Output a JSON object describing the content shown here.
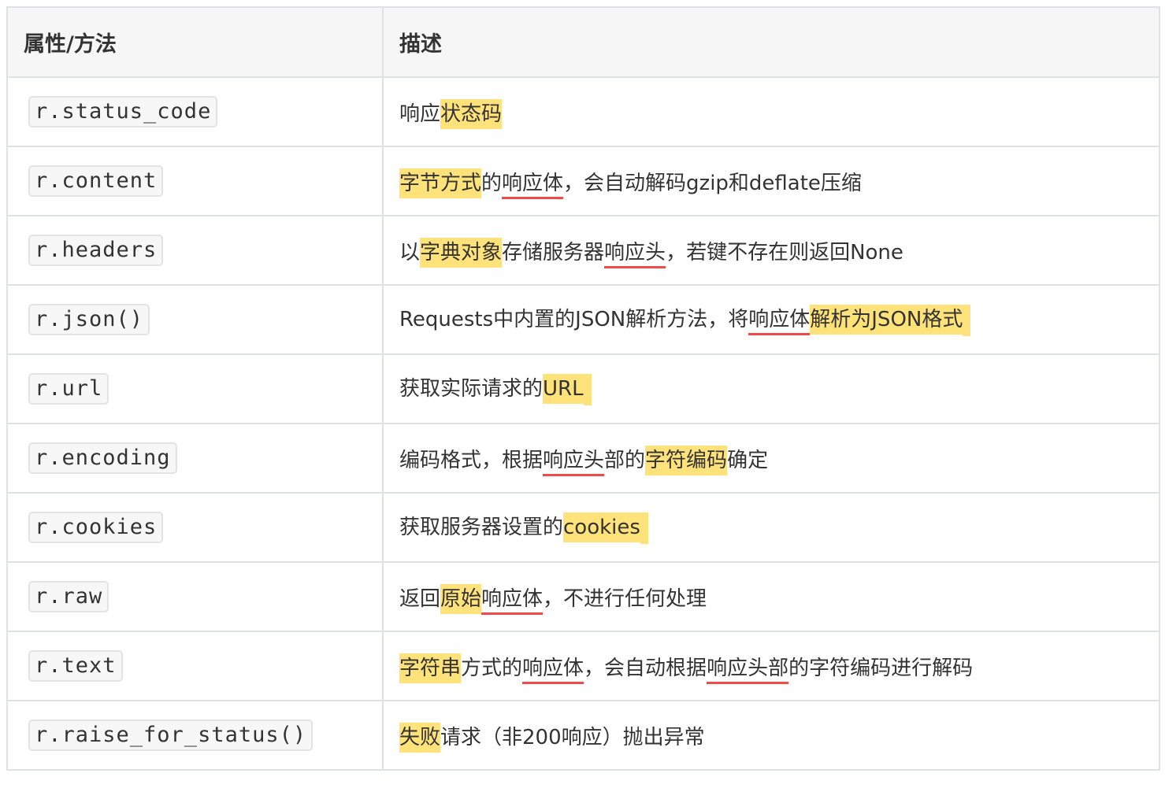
{
  "table": {
    "headers": {
      "property": "属性/方法",
      "description": "描述"
    },
    "rows": [
      {
        "name": "r.status_code",
        "desc": [
          {
            "t": "响应"
          },
          {
            "t": "状态码",
            "hl": true
          }
        ]
      },
      {
        "name": "r.content",
        "desc": [
          {
            "t": "字节方式",
            "hl": true
          },
          {
            "t": "的"
          },
          {
            "t": "响应体",
            "ul": true
          },
          {
            "t": "，会自动解码gzip和deflate压缩"
          }
        ]
      },
      {
        "name": "r.headers",
        "desc": [
          {
            "t": "以"
          },
          {
            "t": "字典对象",
            "hl": true
          },
          {
            "t": "存储服务器"
          },
          {
            "t": "响应头",
            "ul": true
          },
          {
            "t": "，若键不存在则返回None"
          }
        ]
      },
      {
        "name": "r.json()",
        "desc": [
          {
            "t": "Requests中内置的JSON解析方法，将"
          },
          {
            "t": "响应体",
            "ul": true
          },
          {
            "t": "解析为JSON格式",
            "hl": true,
            "tail": true
          }
        ]
      },
      {
        "name": "r.url",
        "desc": [
          {
            "t": "获取实际请求的"
          },
          {
            "t": "URL",
            "hl": true,
            "tail": true
          }
        ]
      },
      {
        "name": "r.encoding",
        "desc": [
          {
            "t": "编码格式，根据"
          },
          {
            "t": "响应头",
            "ul": true
          },
          {
            "t": "部的"
          },
          {
            "t": "字符编码",
            "hl": true
          },
          {
            "t": "确定"
          }
        ]
      },
      {
        "name": "r.cookies",
        "desc": [
          {
            "t": "获取服务器设置的"
          },
          {
            "t": "cookies",
            "hl": true,
            "tail": true
          }
        ]
      },
      {
        "name": "r.raw",
        "desc": [
          {
            "t": "返回"
          },
          {
            "t": "原始",
            "hl": true
          },
          {
            "t": "响应体",
            "ul": true
          },
          {
            "t": "，不进行任何处理"
          }
        ]
      },
      {
        "name": "r.text",
        "desc": [
          {
            "t": "字符串",
            "hl": true
          },
          {
            "t": "方式的"
          },
          {
            "t": "响应体",
            "ul": true
          },
          {
            "t": "，会自动根据"
          },
          {
            "t": "响应头部",
            "ul": true
          },
          {
            "t": "的字符编码进行解码"
          }
        ]
      },
      {
        "name": "r.raise_for_status()",
        "desc": [
          {
            "t": "失败",
            "hl": true
          },
          {
            "t": "请求（非200响应）抛出异常"
          }
        ]
      }
    ],
    "colors": {
      "highlight": "#ffe27a",
      "underline": "#ef4b4b",
      "border": "#dfe2e5",
      "header_bg": "#f6f6f6"
    }
  }
}
